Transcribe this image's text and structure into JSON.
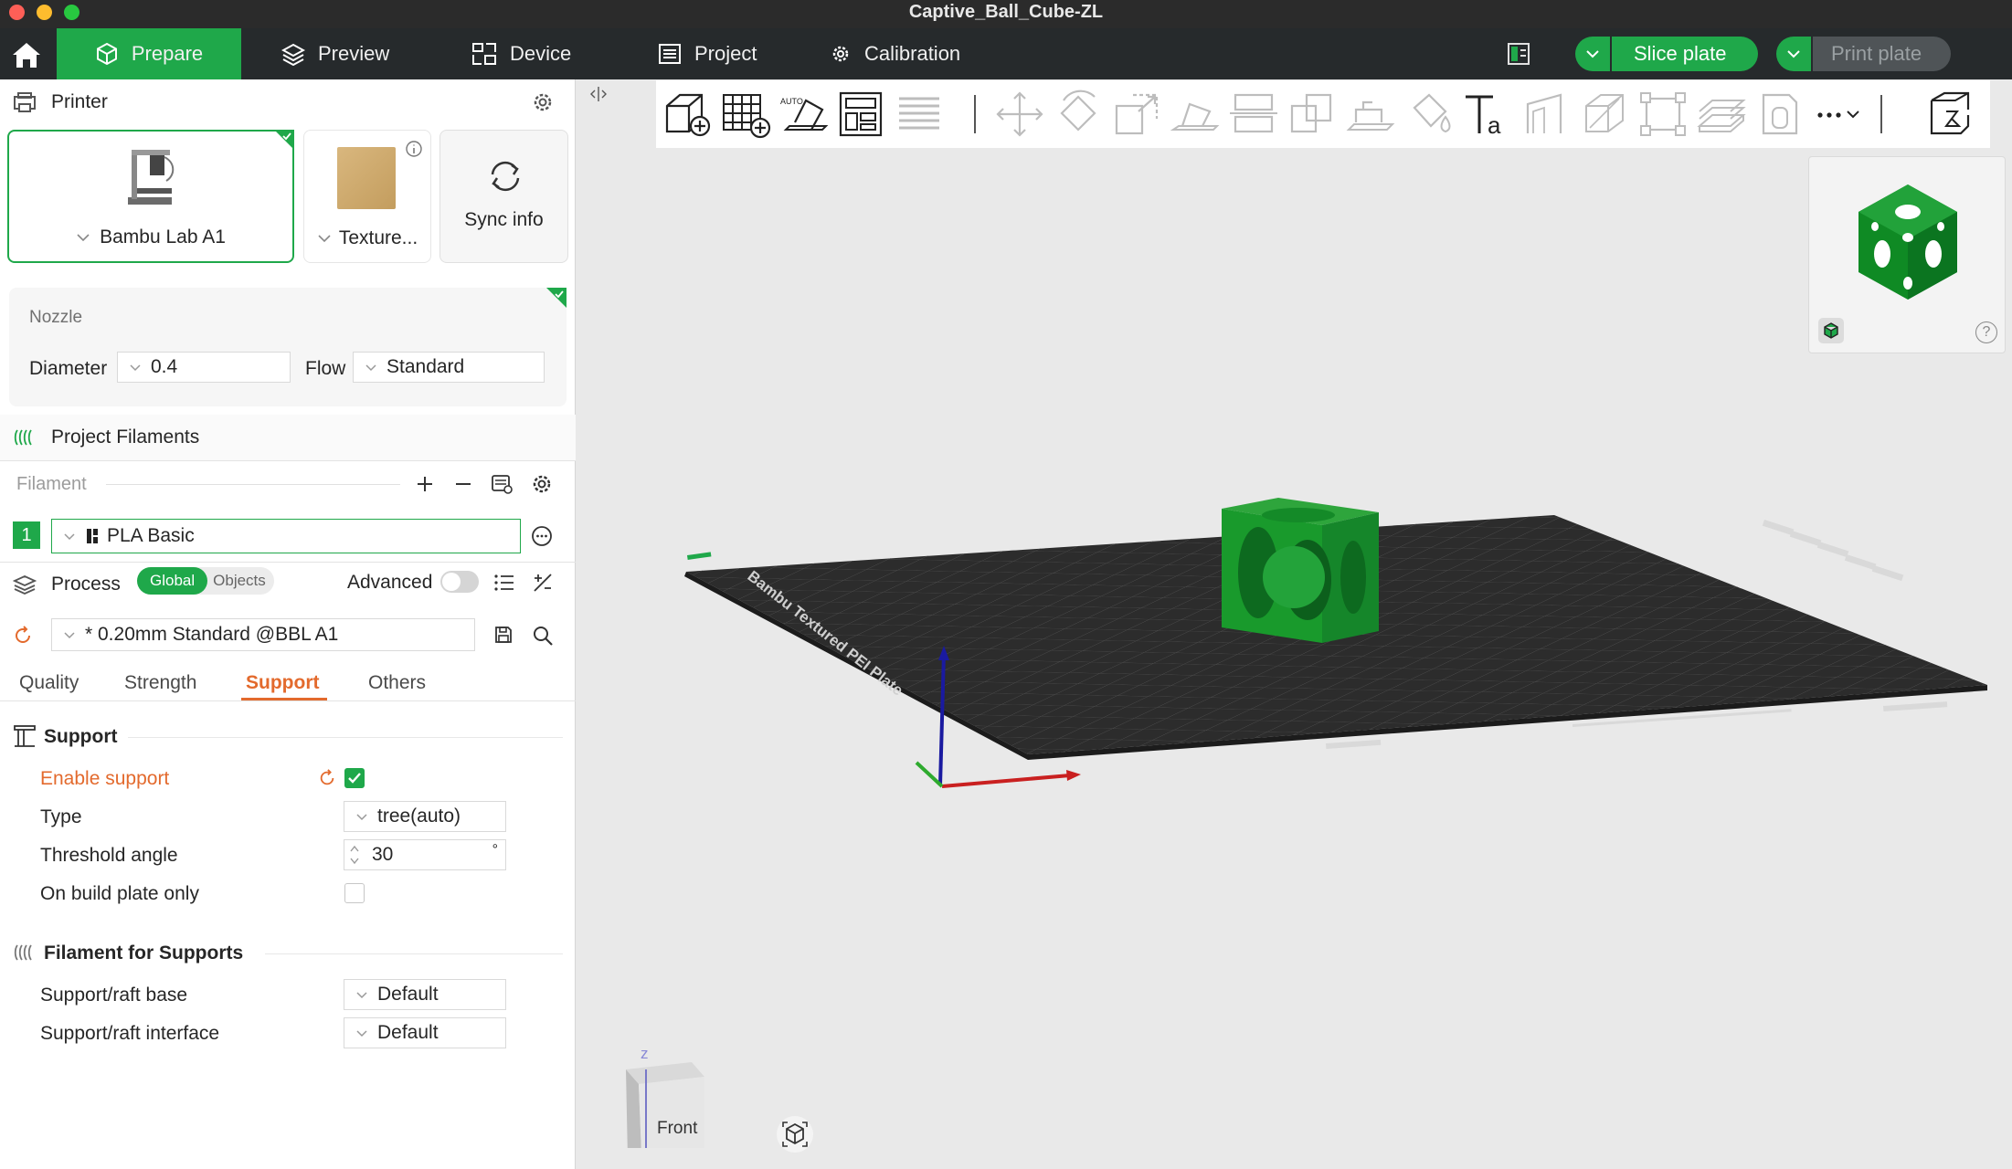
{
  "window": {
    "title": "Captive_Ball_Cube-ZL"
  },
  "nav": {
    "tabs": [
      {
        "label": "Prepare",
        "icon": "cube-icon"
      },
      {
        "label": "Preview",
        "icon": "layers-icon"
      },
      {
        "label": "Device",
        "icon": "device-icon"
      },
      {
        "label": "Project",
        "icon": "list-icon"
      },
      {
        "label": "Calibration",
        "icon": "calibration-gear-icon"
      }
    ],
    "slice_label": "Slice plate",
    "print_label": "Print plate"
  },
  "printer": {
    "header": "Printer",
    "model": "Bambu Lab A1",
    "plate": "Texture...",
    "sync": "Sync info",
    "nozzle_title": "Nozzle",
    "diameter_label": "Diameter",
    "diameter_value": "0.4",
    "flow_label": "Flow",
    "flow_value": "Standard"
  },
  "filaments": {
    "header": "Project Filaments",
    "list_label": "Filament",
    "items": [
      {
        "index": "1",
        "name": "PLA Basic",
        "color": "#1fa84a"
      }
    ]
  },
  "process": {
    "header": "Process",
    "global_label": "Global",
    "objects_label": "Objects",
    "advanced_label": "Advanced",
    "preset": "* 0.20mm Standard @BBL A1",
    "tabs": [
      "Quality",
      "Strength",
      "Support",
      "Others"
    ],
    "active_tab": "Support"
  },
  "support": {
    "title": "Support",
    "enable_label": "Enable support",
    "enable_checked": true,
    "type_label": "Type",
    "type_value": "tree(auto)",
    "threshold_label": "Threshold angle",
    "threshold_value": "30",
    "threshold_unit": "°",
    "buildplate_label": "On build plate only",
    "buildplate_checked": false
  },
  "filament_supports": {
    "title": "Filament for Supports",
    "base_label": "Support/raft base",
    "base_value": "Default",
    "interface_label": "Support/raft interface",
    "interface_value": "Default"
  },
  "viewport": {
    "plate_text": "Bambu Textured PEI Plate",
    "cube_face": "Front",
    "axis_x": "x",
    "axis_y": "y",
    "axis_z": "z",
    "help": "?"
  },
  "colors": {
    "accent": "#1fa84a",
    "highlight": "#e36a2d",
    "nav_bg": "#262a2c"
  }
}
